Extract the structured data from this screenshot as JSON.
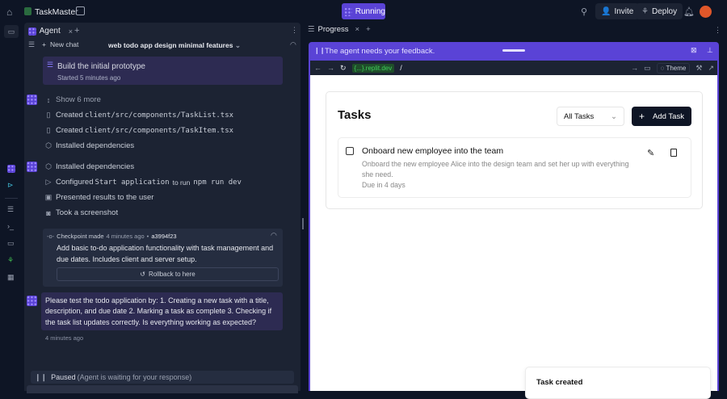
{
  "topbar": {
    "app_name": "TaskMaster",
    "run_label": "Running",
    "invite_label": "Invite",
    "deploy_label": "Deploy"
  },
  "agent_panel": {
    "tab_label": "Agent",
    "new_chat_label": "New chat",
    "chat_title": "web todo app design minimal features",
    "progress_card": {
      "title": "Build the initial prototype",
      "subtitle": "Started 5 minutes ago"
    },
    "group1": [
      {
        "icon": "expand-icon",
        "text": "Show 6 more"
      },
      {
        "icon": "file-icon",
        "text": "Created ",
        "code": "client/src/components/TaskList.tsx"
      },
      {
        "icon": "file-icon",
        "text": "Created ",
        "code": "client/src/components/TaskItem.tsx"
      },
      {
        "icon": "package-icon",
        "text": "Installed dependencies"
      }
    ],
    "group2": [
      {
        "icon": "package-icon",
        "text": "Installed dependencies"
      },
      {
        "icon": "play-icon",
        "text": "Configured ",
        "code": "Start application",
        "text2": " to run ",
        "code2": "npm run dev"
      },
      {
        "icon": "present-icon",
        "text": "Presented results to the user"
      },
      {
        "icon": "camera-icon",
        "text": "Took a screenshot"
      }
    ],
    "checkpoint": {
      "label": "Checkpoint made",
      "time": "4 minutes ago",
      "sep": "•",
      "hash": "a3994f23",
      "message": "Add basic to-do application functionality with task management and due dates. Includes client and server setup.",
      "rollback_label": "Rollback to here"
    },
    "agent_message": {
      "text": "Please test the todo application by: 1. Creating a new task with a title, description, and due date 2. Marking a task as complete 3. Checking if the task list updates correctly. Is everything working as expected?",
      "time": "4 minutes ago"
    },
    "status": {
      "label": "Paused",
      "detail": "(Agent is waiting for your response)"
    }
  },
  "right_panel": {
    "tab_label": "Progress",
    "feedback_banner": "The agent needs your feedback.",
    "url_domain": "{...}.replit.dev",
    "url_path": "/",
    "theme_label": "Theme"
  },
  "app": {
    "title": "Tasks",
    "filter_value": "All Tasks",
    "add_label": "Add Task",
    "task": {
      "title": "Onboard new employee into the team",
      "description": "Onboard the new employee Alice into the design team and set her up with everything she need.",
      "due": "Due in 4 days",
      "completed": false
    },
    "toast_title": "Task created"
  },
  "colors": {
    "accent": "#5a43d6",
    "bg": "#0e1525",
    "panel": "#1c2333"
  }
}
